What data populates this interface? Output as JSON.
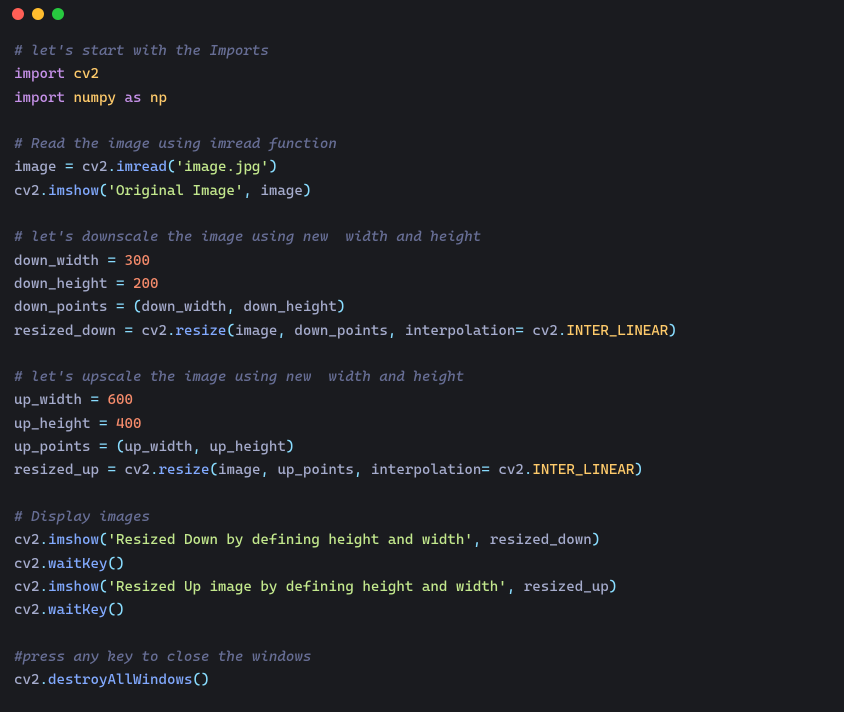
{
  "titlebar": {
    "buttons": [
      "close",
      "minimize",
      "zoom"
    ]
  },
  "code": {
    "colors": {
      "background": "#1a1b1f",
      "comment": "#676e95",
      "keyword": "#c792ea",
      "module": "#ffcb6b",
      "operator": "#89ddff",
      "function": "#82aaff",
      "string": "#c3e88d",
      "number": "#f78c6c",
      "identifier": "#a6accd"
    },
    "lines": [
      {
        "type": "comment",
        "text": "# let's start with the Imports"
      },
      {
        "type": "code",
        "tokens": [
          [
            "kw",
            "import"
          ],
          [
            "sp",
            " "
          ],
          [
            "mod",
            "cv2"
          ]
        ]
      },
      {
        "type": "code",
        "tokens": [
          [
            "kw",
            "import"
          ],
          [
            "sp",
            " "
          ],
          [
            "mod",
            "numpy"
          ],
          [
            "sp",
            " "
          ],
          [
            "kw",
            "as"
          ],
          [
            "sp",
            " "
          ],
          [
            "mod",
            "np"
          ]
        ]
      },
      {
        "type": "blank"
      },
      {
        "type": "comment",
        "text": "# Read the image using imread function"
      },
      {
        "type": "code",
        "tokens": [
          [
            "id",
            "image"
          ],
          [
            "sp",
            " "
          ],
          [
            "op",
            "="
          ],
          [
            "sp",
            " "
          ],
          [
            "id",
            "cv2"
          ],
          [
            "op",
            "."
          ],
          [
            "fn",
            "imread"
          ],
          [
            "op",
            "("
          ],
          [
            "str",
            "'image.jpg'"
          ],
          [
            "op",
            ")"
          ]
        ]
      },
      {
        "type": "code",
        "tokens": [
          [
            "id",
            "cv2"
          ],
          [
            "op",
            "."
          ],
          [
            "fn",
            "imshow"
          ],
          [
            "op",
            "("
          ],
          [
            "str",
            "'Original Image'"
          ],
          [
            "op",
            ","
          ],
          [
            "sp",
            " "
          ],
          [
            "id",
            "image"
          ],
          [
            "op",
            ")"
          ]
        ]
      },
      {
        "type": "blank"
      },
      {
        "type": "comment",
        "text": "# let's downscale the image using new  width and height"
      },
      {
        "type": "code",
        "tokens": [
          [
            "id",
            "down_width"
          ],
          [
            "sp",
            " "
          ],
          [
            "op",
            "="
          ],
          [
            "sp",
            " "
          ],
          [
            "num",
            "300"
          ]
        ]
      },
      {
        "type": "code",
        "tokens": [
          [
            "id",
            "down_height"
          ],
          [
            "sp",
            " "
          ],
          [
            "op",
            "="
          ],
          [
            "sp",
            " "
          ],
          [
            "num",
            "200"
          ]
        ]
      },
      {
        "type": "code",
        "tokens": [
          [
            "id",
            "down_points"
          ],
          [
            "sp",
            " "
          ],
          [
            "op",
            "="
          ],
          [
            "sp",
            " "
          ],
          [
            "op",
            "("
          ],
          [
            "id",
            "down_width"
          ],
          [
            "op",
            ","
          ],
          [
            "sp",
            " "
          ],
          [
            "id",
            "down_height"
          ],
          [
            "op",
            ")"
          ]
        ]
      },
      {
        "type": "code",
        "tokens": [
          [
            "id",
            "resized_down"
          ],
          [
            "sp",
            " "
          ],
          [
            "op",
            "="
          ],
          [
            "sp",
            " "
          ],
          [
            "id",
            "cv2"
          ],
          [
            "op",
            "."
          ],
          [
            "fn",
            "resize"
          ],
          [
            "op",
            "("
          ],
          [
            "id",
            "image"
          ],
          [
            "op",
            ","
          ],
          [
            "sp",
            " "
          ],
          [
            "id",
            "down_points"
          ],
          [
            "op",
            ","
          ],
          [
            "sp",
            " "
          ],
          [
            "id",
            "interpolation"
          ],
          [
            "op",
            "="
          ],
          [
            "sp",
            " "
          ],
          [
            "id",
            "cv2"
          ],
          [
            "op",
            "."
          ],
          [
            "const",
            "INTER_LINEAR"
          ],
          [
            "op",
            ")"
          ]
        ]
      },
      {
        "type": "blank"
      },
      {
        "type": "comment",
        "text": "# let's upscale the image using new  width and height"
      },
      {
        "type": "code",
        "tokens": [
          [
            "id",
            "up_width"
          ],
          [
            "sp",
            " "
          ],
          [
            "op",
            "="
          ],
          [
            "sp",
            " "
          ],
          [
            "num",
            "600"
          ]
        ]
      },
      {
        "type": "code",
        "tokens": [
          [
            "id",
            "up_height"
          ],
          [
            "sp",
            " "
          ],
          [
            "op",
            "="
          ],
          [
            "sp",
            " "
          ],
          [
            "num",
            "400"
          ]
        ]
      },
      {
        "type": "code",
        "tokens": [
          [
            "id",
            "up_points"
          ],
          [
            "sp",
            " "
          ],
          [
            "op",
            "="
          ],
          [
            "sp",
            " "
          ],
          [
            "op",
            "("
          ],
          [
            "id",
            "up_width"
          ],
          [
            "op",
            ","
          ],
          [
            "sp",
            " "
          ],
          [
            "id",
            "up_height"
          ],
          [
            "op",
            ")"
          ]
        ]
      },
      {
        "type": "code",
        "tokens": [
          [
            "id",
            "resized_up"
          ],
          [
            "sp",
            " "
          ],
          [
            "op",
            "="
          ],
          [
            "sp",
            " "
          ],
          [
            "id",
            "cv2"
          ],
          [
            "op",
            "."
          ],
          [
            "fn",
            "resize"
          ],
          [
            "op",
            "("
          ],
          [
            "id",
            "image"
          ],
          [
            "op",
            ","
          ],
          [
            "sp",
            " "
          ],
          [
            "id",
            "up_points"
          ],
          [
            "op",
            ","
          ],
          [
            "sp",
            " "
          ],
          [
            "id",
            "interpolation"
          ],
          [
            "op",
            "="
          ],
          [
            "sp",
            " "
          ],
          [
            "id",
            "cv2"
          ],
          [
            "op",
            "."
          ],
          [
            "const",
            "INTER_LINEAR"
          ],
          [
            "op",
            ")"
          ]
        ]
      },
      {
        "type": "blank"
      },
      {
        "type": "comment",
        "text": "# Display images"
      },
      {
        "type": "code",
        "tokens": [
          [
            "id",
            "cv2"
          ],
          [
            "op",
            "."
          ],
          [
            "fn",
            "imshow"
          ],
          [
            "op",
            "("
          ],
          [
            "str",
            "'Resized Down by defining height and width'"
          ],
          [
            "op",
            ","
          ],
          [
            "sp",
            " "
          ],
          [
            "id",
            "resized_down"
          ],
          [
            "op",
            ")"
          ]
        ]
      },
      {
        "type": "code",
        "tokens": [
          [
            "id",
            "cv2"
          ],
          [
            "op",
            "."
          ],
          [
            "fn",
            "waitKey"
          ],
          [
            "op",
            "("
          ],
          [
            "op",
            ")"
          ]
        ]
      },
      {
        "type": "code",
        "tokens": [
          [
            "id",
            "cv2"
          ],
          [
            "op",
            "."
          ],
          [
            "fn",
            "imshow"
          ],
          [
            "op",
            "("
          ],
          [
            "str",
            "'Resized Up image by defining height and width'"
          ],
          [
            "op",
            ","
          ],
          [
            "sp",
            " "
          ],
          [
            "id",
            "resized_up"
          ],
          [
            "op",
            ")"
          ]
        ]
      },
      {
        "type": "code",
        "tokens": [
          [
            "id",
            "cv2"
          ],
          [
            "op",
            "."
          ],
          [
            "fn",
            "waitKey"
          ],
          [
            "op",
            "("
          ],
          [
            "op",
            ")"
          ]
        ]
      },
      {
        "type": "blank"
      },
      {
        "type": "comment",
        "text": "#press any key to close the windows"
      },
      {
        "type": "code",
        "tokens": [
          [
            "id",
            "cv2"
          ],
          [
            "op",
            "."
          ],
          [
            "fn",
            "destroyAllWindows"
          ],
          [
            "op",
            "("
          ],
          [
            "op",
            ")"
          ]
        ]
      }
    ]
  }
}
